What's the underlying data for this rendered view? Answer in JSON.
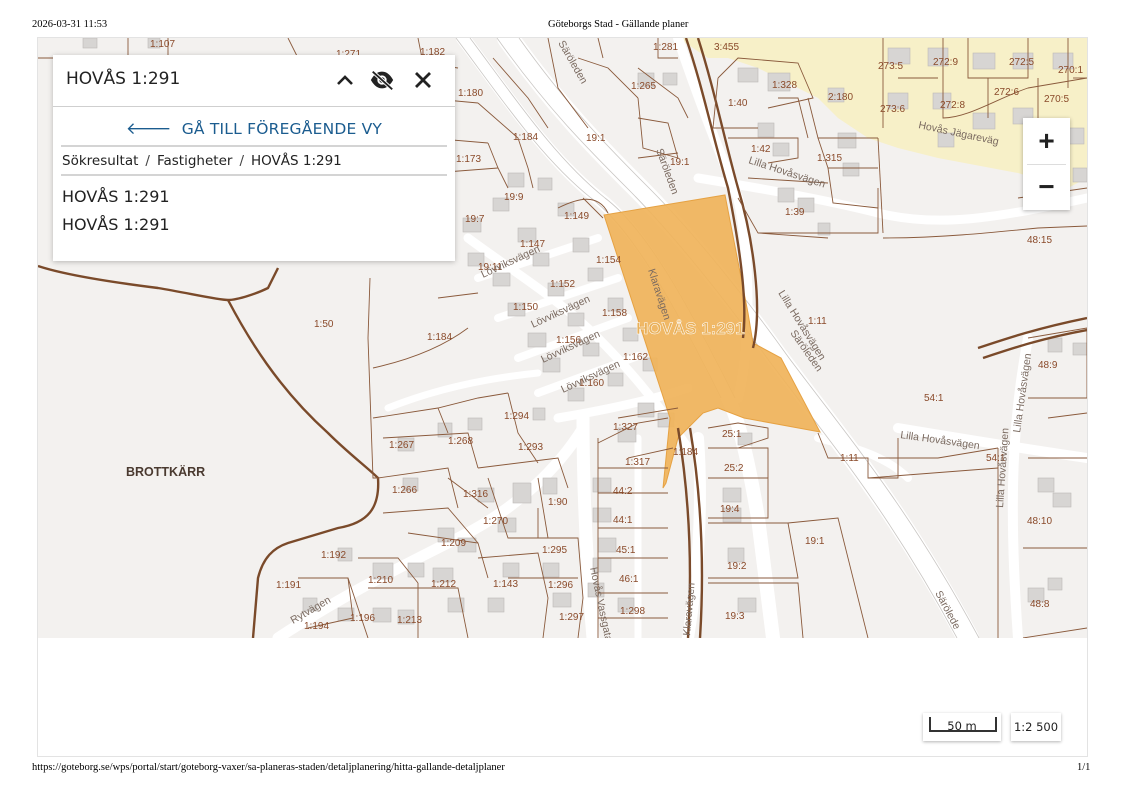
{
  "print_header": {
    "datetime": "2026-03-31 11:53",
    "title": "Göteborgs Stad - Gällande planer"
  },
  "print_footer": {
    "url": "https://goteborg.se/wps/portal/start/goteborg-vaxer/sa-planeras-staden/detaljplanering/hitta-gallande-detaljplaner",
    "page": "1/1"
  },
  "search_panel": {
    "title": "HOVÅS 1:291",
    "collapse_icon": "chevron-up-icon",
    "hide_icon": "eye-off-icon",
    "close_icon": "close-icon",
    "back_label": "GÅ TILL FÖREGÅENDE VY",
    "breadcrumb": [
      "Sökresultat",
      "Fastigheter",
      "HOVÅS 1:291"
    ],
    "results": [
      "HOVÅS 1:291",
      "HOVÅS 1:291"
    ]
  },
  "zoom": {
    "in_label": "+",
    "out_label": "−"
  },
  "scale": {
    "bar_label": "50 m",
    "ratio": "1:2 500"
  },
  "colors": {
    "highlight_fill": "#f0b35a",
    "highlight_label": "#e3a94e",
    "parcel_line": "#8a5a3c",
    "district_line": "#7a4a2a",
    "road_fill": "#ffffff",
    "base": "#f3f1ef",
    "building": "#d7d5d3",
    "planned_area": "#f7f0c8",
    "link": "#1b5c8f"
  },
  "map": {
    "highlight_label": "HOVÅS 1:291",
    "area_label": "BROTTKÄRR",
    "parcel_labels": [
      "1:107",
      "1:271",
      "1:182",
      "1:180",
      "1:173",
      "1:184",
      "19:9",
      "19:7",
      "1:147",
      "1:149",
      "19:11",
      "1:154",
      "1:152",
      "1:150",
      "1:158",
      "1:156",
      "1:162",
      "1:160",
      "1:50",
      "1:184",
      "1:294",
      "1:267",
      "1:268",
      "1:293",
      "1:327",
      "1:317",
      "1:184",
      "1:266",
      "1:316",
      "1:270",
      "1:90",
      "1:209",
      "1:295",
      "1:192",
      "1:210",
      "1:212",
      "1:143",
      "1:296",
      "1:191",
      "1:194",
      "1:196",
      "1:213",
      "1:297",
      "1:298",
      "44:2",
      "44:1",
      "45:1",
      "46:1",
      "1:281",
      "3:455",
      "1:265",
      "19:1",
      "1:40",
      "1:328",
      "2:180",
      "1:42",
      "1:315",
      "19:1",
      "1:39",
      "273:5",
      "272:9",
      "272:5",
      "270:1",
      "273:6",
      "272:8",
      "272:6",
      "270:5",
      "48:15",
      "1:11",
      "48:9",
      "54:1",
      "25:1",
      "25:2",
      "1:11",
      "54:1",
      "19:4",
      "19:1",
      "48:10",
      "19:2",
      "19:3",
      "48:8"
    ],
    "street_labels": [
      "Lövviksvägen",
      "Lövviksvägen",
      "Lövviksvägen",
      "Lövviksvägen",
      "Säröleden",
      "Säröleden",
      "Säröleden",
      "Lilla Hovåsvägen",
      "Lilla Hovåsvägen",
      "Lilla Hovåsvägen",
      "Lilla Hovåsvägen",
      "Hovås Jägareväg",
      "Klaravägen",
      "Klaravägen",
      "Hovås Vassgata",
      "Rytvägen",
      "Särölede"
    ]
  }
}
